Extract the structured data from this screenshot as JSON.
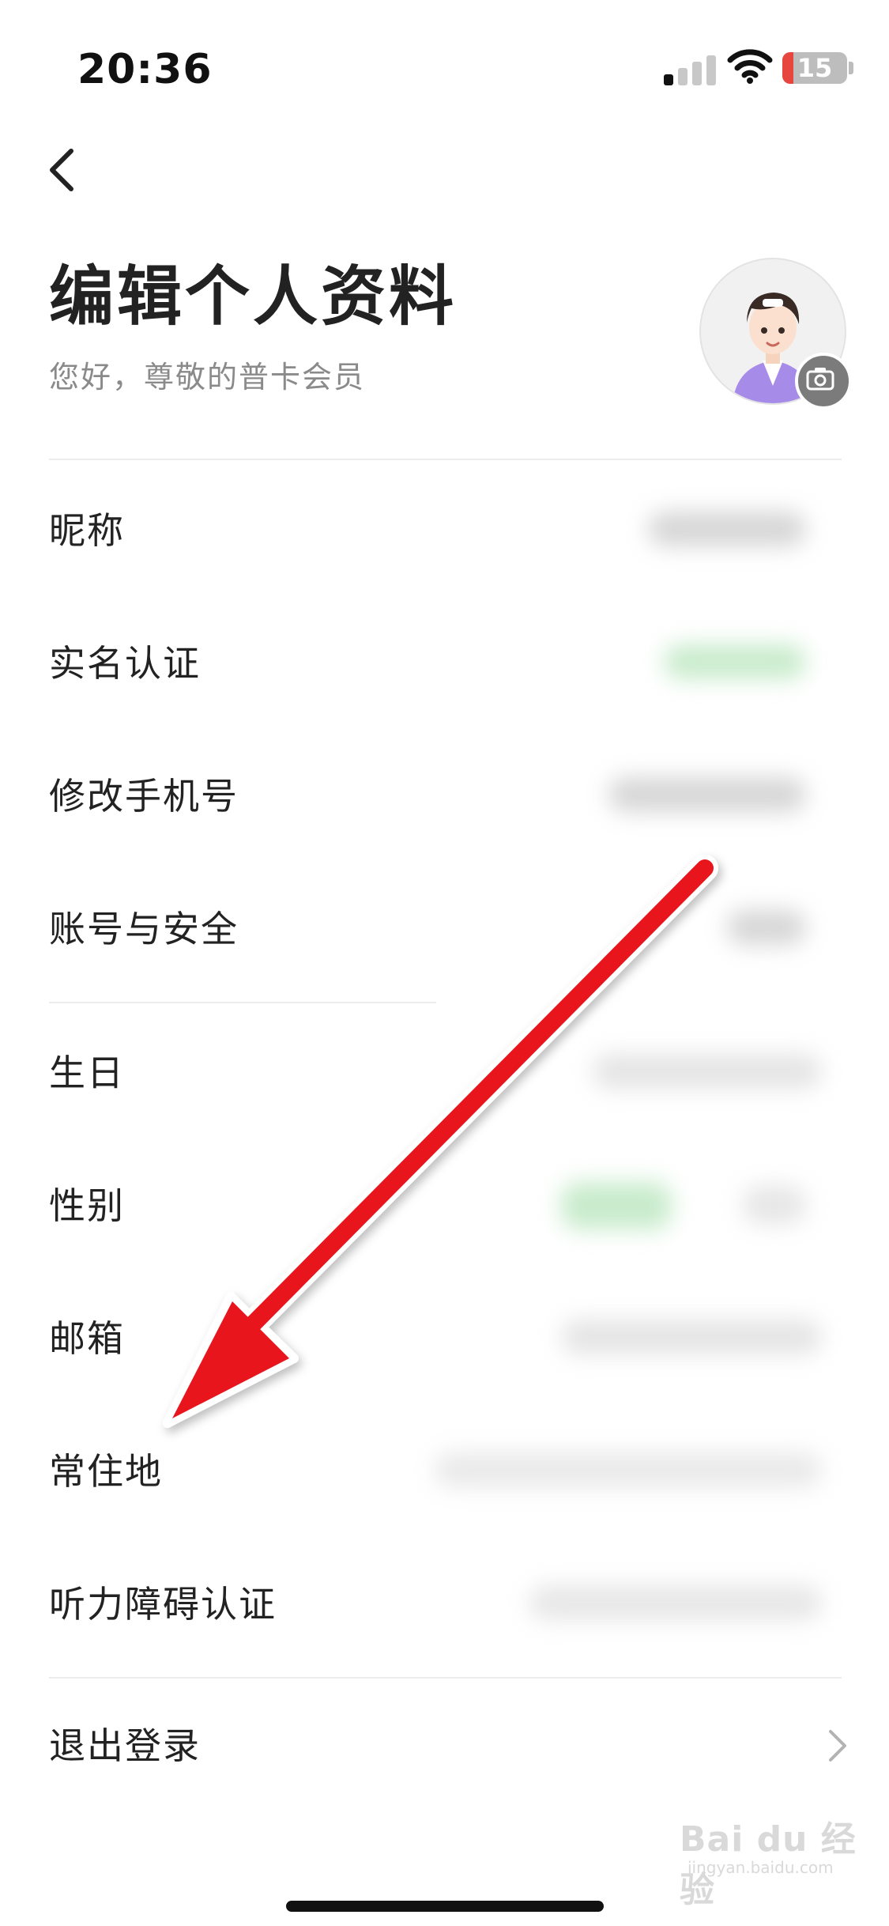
{
  "status_bar": {
    "time": "20:36",
    "battery_level": "15",
    "icons": [
      "cellular-signal-icon",
      "wifi-icon",
      "battery-icon"
    ]
  },
  "header": {
    "back_icon": "chevron-left-icon",
    "title": "编辑个人资料",
    "subtitle": "您好，尊敬的普卡会员",
    "camera_icon": "camera-icon"
  },
  "rows": [
    {
      "label": "昵称"
    },
    {
      "label": "实名认证"
    },
    {
      "label": "修改手机号"
    },
    {
      "label": "账号与安全"
    },
    {
      "label": "生日"
    },
    {
      "label": "性别"
    },
    {
      "label": "邮箱"
    },
    {
      "label": "常住地"
    },
    {
      "label": "听力障碍认证"
    },
    {
      "label": "退出登录"
    }
  ],
  "annotation": {
    "arrow_color": "#e8121b"
  },
  "watermark": {
    "text": "Bai du 经验",
    "sub": "jingyan.baidu.com"
  },
  "colors": {
    "verified_green": "#cdeccf",
    "title": "#222222",
    "subtitle": "#8a8a8a"
  }
}
